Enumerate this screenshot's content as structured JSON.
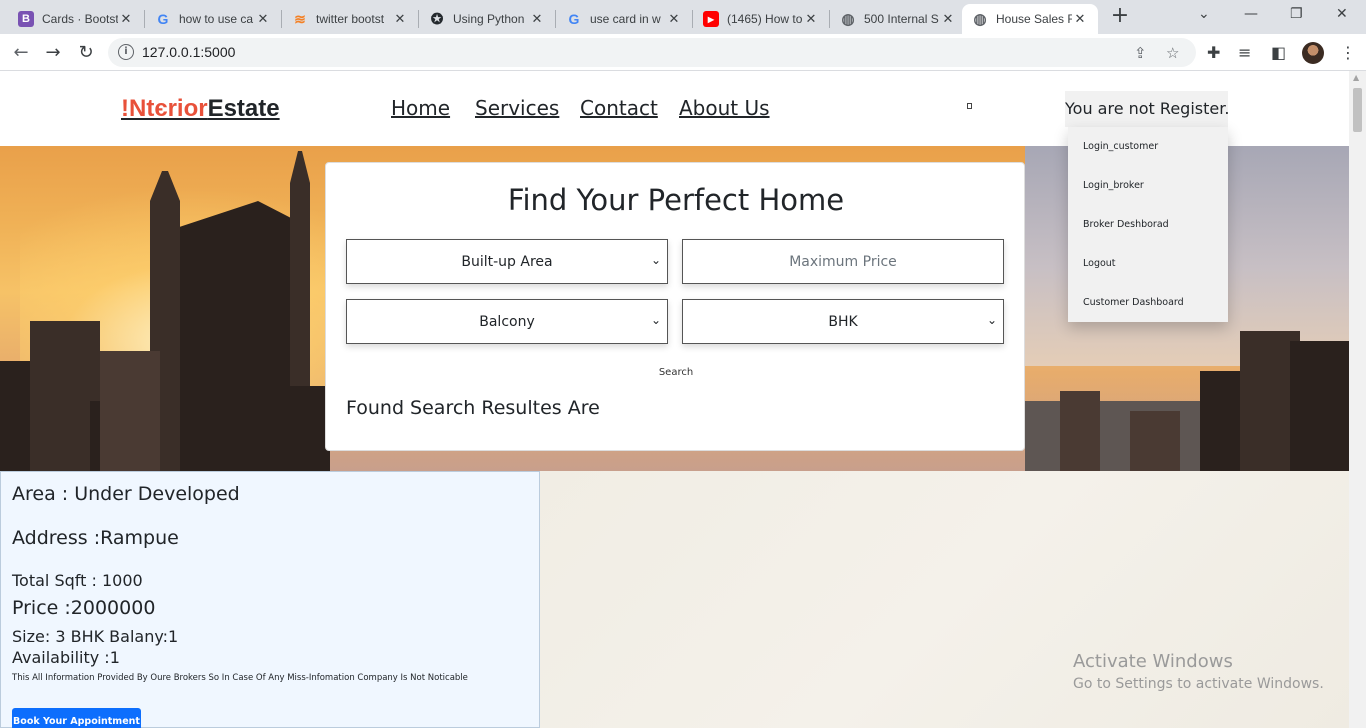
{
  "browser": {
    "tabs": [
      {
        "title": "Cards · Bootst",
        "icon": "bootstrap-icon",
        "color": "#7952b3",
        "glyph": "B"
      },
      {
        "title": "how to use ca",
        "icon": "google-icon",
        "color": "#4285f4",
        "glyph": "G"
      },
      {
        "title": "twitter bootst",
        "icon": "stackoverflow-icon",
        "color": "#f48024",
        "glyph": "≋"
      },
      {
        "title": "Using Python",
        "icon": "github-icon",
        "color": "#24292e",
        "glyph": "✪"
      },
      {
        "title": "use card in w",
        "icon": "google-icon",
        "color": "#4285f4",
        "glyph": "G"
      },
      {
        "title": "(1465) How to",
        "icon": "youtube-icon",
        "color": "#ff0000",
        "glyph": "▶"
      },
      {
        "title": "500 Internal S",
        "icon": "globe-icon",
        "color": "#5f6368",
        "glyph": "◍"
      },
      {
        "title": "House Sales F",
        "icon": "globe-icon",
        "color": "#5f6368",
        "glyph": "◍"
      }
    ],
    "url": "127.0.0.1:5000"
  },
  "nav": {
    "brand_part1": "!Ntєrior",
    "brand_part2": "Estate",
    "links": [
      "Home",
      "Services",
      "Contact",
      "About Us"
    ],
    "register_status": "You are not Register."
  },
  "dropdown": {
    "items": [
      "Login_customer",
      "Login_broker",
      "Broker Deshborad",
      "Logout",
      "Customer Dashboard"
    ]
  },
  "search": {
    "title": "Find Your Perfect Home",
    "area_select": "Built-up Area",
    "price_placeholder": "Maximum Price",
    "balcony_select": "Balcony",
    "bhk_select": "BHK",
    "search_label": "Search",
    "results_heading": "Found Search Resultes Are"
  },
  "result": {
    "area": "Area : Under Developed",
    "address": "Address :Rampue",
    "sqft": "Total Sqft : 1000",
    "price": "Price :2000000",
    "size": "Size: 3 BHK Balany:1",
    "availability": "Availability :1",
    "disclaimer": "This All Information Provided By Oure Brokers So In Case Of Any Miss-Infomation Company Is Not Noticable",
    "book_button": "Book Your Appointment"
  },
  "os": {
    "activate_title": "Activate Windows",
    "activate_sub": "Go to Settings to activate Windows."
  }
}
